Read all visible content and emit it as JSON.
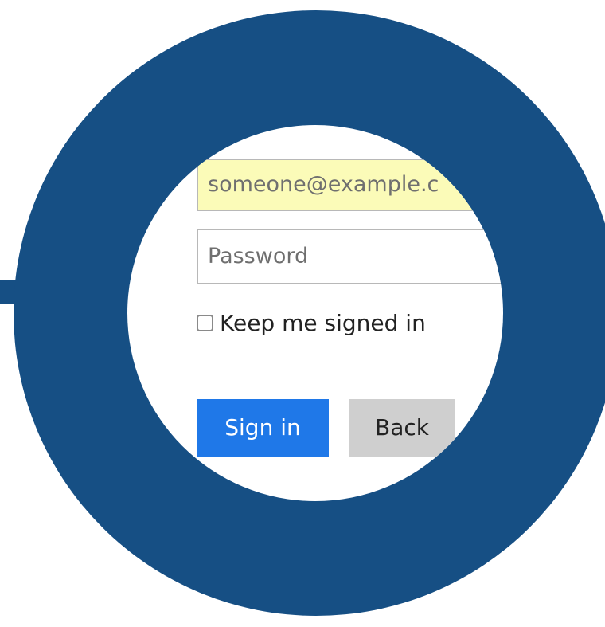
{
  "form": {
    "email_value": "someone@example.c",
    "password_placeholder": "Password",
    "keep_signed_in_label": "Keep me signed in",
    "keep_signed_in_checked": false,
    "signin_label": "Sign in",
    "back_label": "Back"
  },
  "colors": {
    "ring": "#164f84",
    "email_autofill_bg": "#fbfbb8",
    "signin_bg": "#1f78e8",
    "back_bg": "#cfcfcf"
  }
}
